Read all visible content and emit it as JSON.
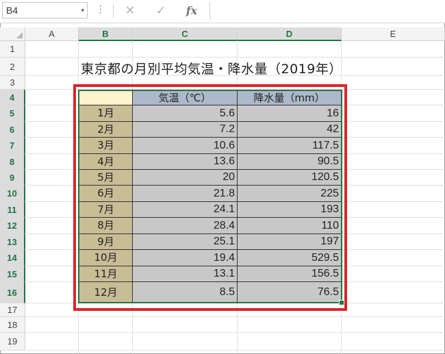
{
  "formula_bar": {
    "name_box": "B4",
    "name_box_arrow": "▾",
    "dots": "⋮",
    "cancel_glyph": "✕",
    "enter_glyph": "✓",
    "fx_glyph": "fx",
    "formula": ""
  },
  "columns": [
    "A",
    "B",
    "C",
    "D",
    "E"
  ],
  "rows": [
    "1",
    "2",
    "3",
    "4",
    "5",
    "6",
    "7",
    "8",
    "9",
    "10",
    "11",
    "12",
    "13",
    "14",
    "15",
    "16",
    "17",
    "18",
    "19"
  ],
  "title": "東京都の月別平均気温・降水量（2019年）",
  "table": {
    "headers": [
      "",
      "気温（℃）",
      "降水量（mm）"
    ],
    "rows": [
      {
        "month": "1月",
        "temp": "5.6",
        "rain": "16"
      },
      {
        "month": "2月",
        "temp": "7.2",
        "rain": "42"
      },
      {
        "month": "3月",
        "temp": "10.6",
        "rain": "117.5"
      },
      {
        "month": "4月",
        "temp": "13.6",
        "rain": "90.5"
      },
      {
        "month": "5月",
        "temp": "20",
        "rain": "120.5"
      },
      {
        "month": "6月",
        "temp": "21.8",
        "rain": "225"
      },
      {
        "month": "7月",
        "temp": "24.1",
        "rain": "193"
      },
      {
        "month": "8月",
        "temp": "28.4",
        "rain": "110"
      },
      {
        "month": "9月",
        "temp": "25.1",
        "rain": "197"
      },
      {
        "month": "10月",
        "temp": "19.4",
        "rain": "529.5"
      },
      {
        "month": "11月",
        "temp": "13.1",
        "rain": "156.5"
      },
      {
        "month": "12月",
        "temp": "8.5",
        "rain": "76.5"
      }
    ]
  },
  "colors": {
    "header_b": "#fff2cc",
    "header_cd": "#adb9ca",
    "month_fill": "#c9bd96",
    "value_fill": "#c8c8c8",
    "selection": "#217346",
    "highlight": "#d9262b"
  }
}
